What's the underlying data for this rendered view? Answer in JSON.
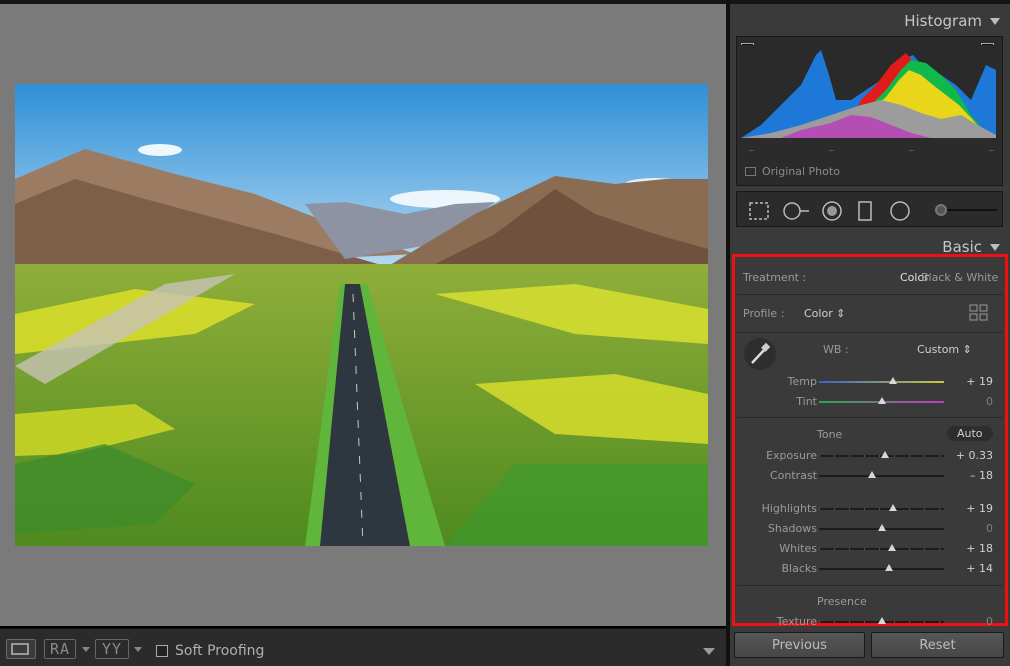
{
  "panel": {
    "histogram_title": "Histogram",
    "original_photo_label": "Original Photo",
    "hist_ticks": [
      "–",
      "–",
      "–",
      "–"
    ],
    "basic_title": "Basic"
  },
  "basic": {
    "treatment_label": "Treatment :",
    "treatment_color": "Color",
    "treatment_bw": "Black & White",
    "profile_label": "Profile :",
    "profile_value": "Color ⇕",
    "wb_label": "WB :",
    "wb_value": "Custom ⇕",
    "temp": {
      "label": "Temp",
      "value": "+ 19",
      "position": 0.59
    },
    "tint": {
      "label": "Tint",
      "value": "0",
      "position": 0.5
    },
    "tone_label": "Tone",
    "auto_label": "Auto",
    "exposure": {
      "label": "Exposure",
      "value": "+ 0.33",
      "position": 0.53
    },
    "contrast": {
      "label": "Contrast",
      "value": "– 18",
      "position": 0.42
    },
    "highlights": {
      "label": "Highlights",
      "value": "+ 19",
      "position": 0.59
    },
    "shadows": {
      "label": "Shadows",
      "value": "0",
      "position": 0.5
    },
    "whites": {
      "label": "Whites",
      "value": "+ 18",
      "position": 0.58
    },
    "blacks": {
      "label": "Blacks",
      "value": "+ 14",
      "position": 0.56
    },
    "presence_label": "Presence",
    "texture": {
      "label": "Texture",
      "value": "0",
      "position": 0.5
    }
  },
  "buttons": {
    "previous": "Previous",
    "reset": "Reset"
  },
  "toolbar": {
    "view_ra": "RA",
    "view_yy": "YY",
    "soft_proofing": "Soft Proofing"
  },
  "colors": {
    "highlight_border": "#ee1111",
    "panel_bg": "#3a3a3a",
    "canvas_bg": "#7a7a7a"
  }
}
